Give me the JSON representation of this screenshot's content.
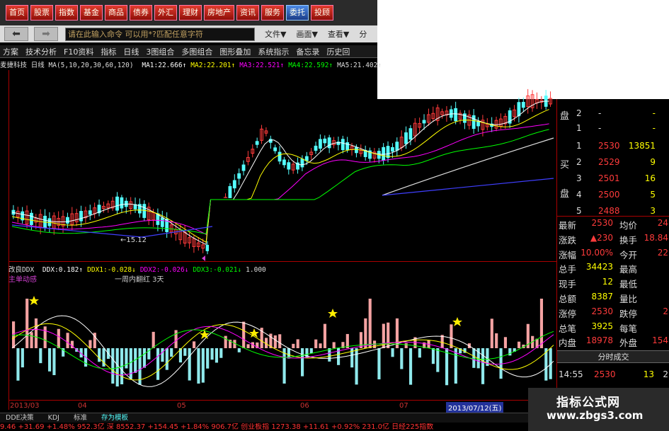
{
  "top_nav": {
    "items": [
      "首页",
      "股票",
      "指数",
      "基金",
      "商品",
      "债券",
      "外汇",
      "理财",
      "房地产",
      "资讯",
      "服务",
      "委托",
      "投顾"
    ],
    "highlighted": "委托"
  },
  "toolbar": {
    "back_icon": "arrow-left-icon",
    "forward_icon": "arrow-right-icon",
    "command_placeholder": "请在此输入命令   可以用*?匹配任意字符",
    "menus": [
      "文件▼",
      "画面▼",
      "查看▼",
      "分"
    ]
  },
  "function_bar": {
    "items": [
      "方案",
      "技术分析",
      "F10资料",
      "指标",
      "日线",
      "3图组合",
      "多图组合",
      "图形叠加",
      "系统指示",
      "备忘录",
      "历史回"
    ]
  },
  "chart_header": {
    "stock": "麦捷科技",
    "period": "日线",
    "ma_params": "MA(5,10,20,30,60,120)",
    "ma_values": [
      {
        "label": "MA1:",
        "value": "22.666",
        "arrow": "↑",
        "color": "#ffffff"
      },
      {
        "label": "MA2:",
        "value": "22.201",
        "arrow": "↑",
        "color": "#ffff00"
      },
      {
        "label": "MA3:",
        "value": "22.521",
        "arrow": "↑",
        "color": "#ff00ff"
      },
      {
        "label": "MA4:",
        "value": "22.592",
        "arrow": "↑",
        "color": "#00ff00"
      },
      {
        "label": "MA5:",
        "value": "21.402",
        "arrow": "↑",
        "color": "#dddddd"
      }
    ],
    "low_price_label": "←15.12",
    "colors": {
      "up": "#ff3b3b",
      "down": "#54ffff",
      "ma1": "#ffffff",
      "ma2": "#ffff00",
      "ma3": "#ff00ff",
      "ma4": "#00ff00",
      "ma5": "#dddddd",
      "ma6": "#3f3fff",
      "grid": "#aa0000"
    }
  },
  "indicator": {
    "name": "改良DDX",
    "values": [
      {
        "label": "DDX:",
        "value": "0.182",
        "arrow": "↑",
        "color": "#ffffff"
      },
      {
        "label": "DDX1:",
        "value": "-0.028",
        "arrow": "↓",
        "color": "#ffff00"
      },
      {
        "label": "DDX2:",
        "value": "-0.026",
        "arrow": "↓",
        "color": "#ff00ff"
      },
      {
        "label": "DDX3:",
        "value": "-0.021",
        "arrow": "↓",
        "color": "#00ff00"
      },
      {
        "label": "",
        "value": "1.000",
        "arrow": "",
        "color": "#dddddd"
      }
    ],
    "sub_label": "主单动感",
    "annotation": "一周内翻红 3天",
    "star_icon": "star-icon"
  },
  "x_axis": {
    "dates": [
      "2013/03",
      "04",
      "05",
      "06",
      "07",
      "2013/07/12(五)"
    ]
  },
  "bottom_tabs": {
    "items": [
      "DDE决策",
      "KDJ",
      "标准",
      "存为模板"
    ],
    "active": "存为模板"
  },
  "ticker": "9.46  +31.69  +1.48%  952.3亿 深    8552.37  +154.45  +1.84%  906.7亿 创业板指 1273.38 +11.61 +0.92%  231.0亿 日经225指数",
  "quote_panel": {
    "sell_label": "盘",
    "sell_rows": [
      {
        "level": "2",
        "price": "-",
        "vol": "-"
      },
      {
        "level": "1",
        "price": "-",
        "vol": "-"
      }
    ],
    "buy_labels": [
      "买",
      "盘"
    ],
    "buy_rows": [
      {
        "level": "1",
        "price": "2530",
        "vol": "13851"
      },
      {
        "level": "2",
        "price": "2529",
        "vol": "9"
      },
      {
        "level": "3",
        "price": "2501",
        "vol": "16"
      },
      {
        "level": "4",
        "price": "2500",
        "vol": "5"
      },
      {
        "level": "5",
        "price": "2488",
        "vol": "3"
      }
    ],
    "stats": [
      {
        "l": "最新",
        "v": "2530",
        "l2": "均价",
        "v2": "24"
      },
      {
        "l": "涨跌",
        "v": "▲230",
        "l2": "换手",
        "v2": "18.84"
      },
      {
        "l": "涨幅",
        "v": "10.00%",
        "l2": "今开",
        "v2": "22"
      },
      {
        "l": "总手",
        "v": "34423",
        "l2": "最高",
        "v2": ""
      },
      {
        "l": "现手",
        "v": "12",
        "l2": "最低",
        "v2": ""
      },
      {
        "l": "总额",
        "v": "8387",
        "l2": "量比",
        "v2": ""
      },
      {
        "l": "涨停",
        "v": "2530",
        "l2": "跌停",
        "v2": "2"
      },
      {
        "l": "总笔",
        "v": "3925",
        "l2": "每笔",
        "v2": ""
      },
      {
        "l": "内盘",
        "v": "18978",
        "l2": "外盘",
        "v2": "154"
      }
    ],
    "time_sales_title": "分时成交",
    "last_trade": {
      "time": "14:55",
      "price": "2530",
      "vol": "13",
      "extra": "2"
    }
  },
  "watermark": {
    "line1": "指标公式网",
    "line2": "www.zbgs3.com"
  }
}
